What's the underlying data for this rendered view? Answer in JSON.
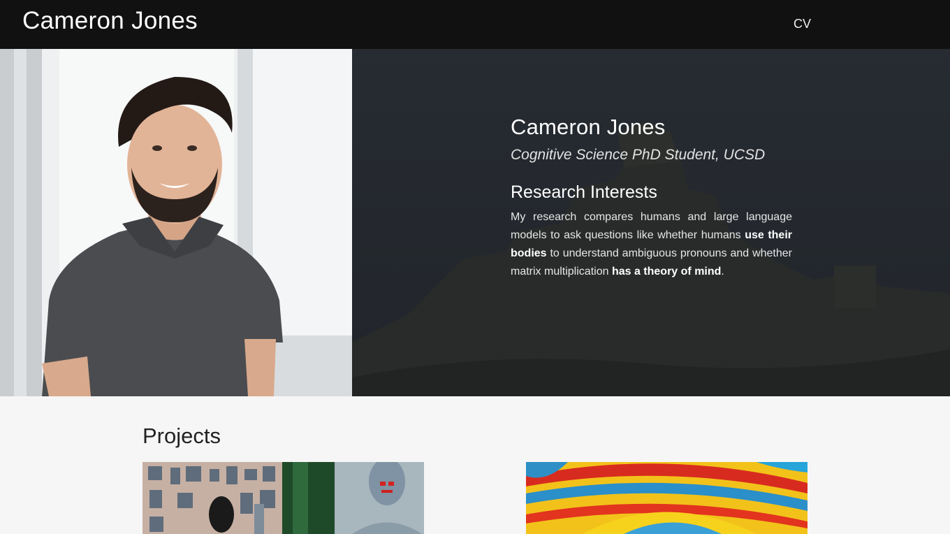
{
  "header": {
    "site_title": "Cameron Jones",
    "nav_cv": "CV"
  },
  "hero": {
    "name": "Cameron Jones",
    "subtitle": "Cognitive Science PhD Student, UCSD",
    "section_heading": "Research Interests",
    "paragraph": {
      "part1": "My research compares humans and large language models to ask questions like whether humans ",
      "bold1": "use their bodies",
      "part2": " to understand ambiguous pronouns and whether matrix multiplication ",
      "bold2": "has a theory of mind",
      "part3": "."
    }
  },
  "projects": {
    "heading": "Projects"
  },
  "colors": {
    "nav_bg": "#111111",
    "page_bg": "#f6f6f6",
    "hero_overlay": "#1f2227"
  }
}
